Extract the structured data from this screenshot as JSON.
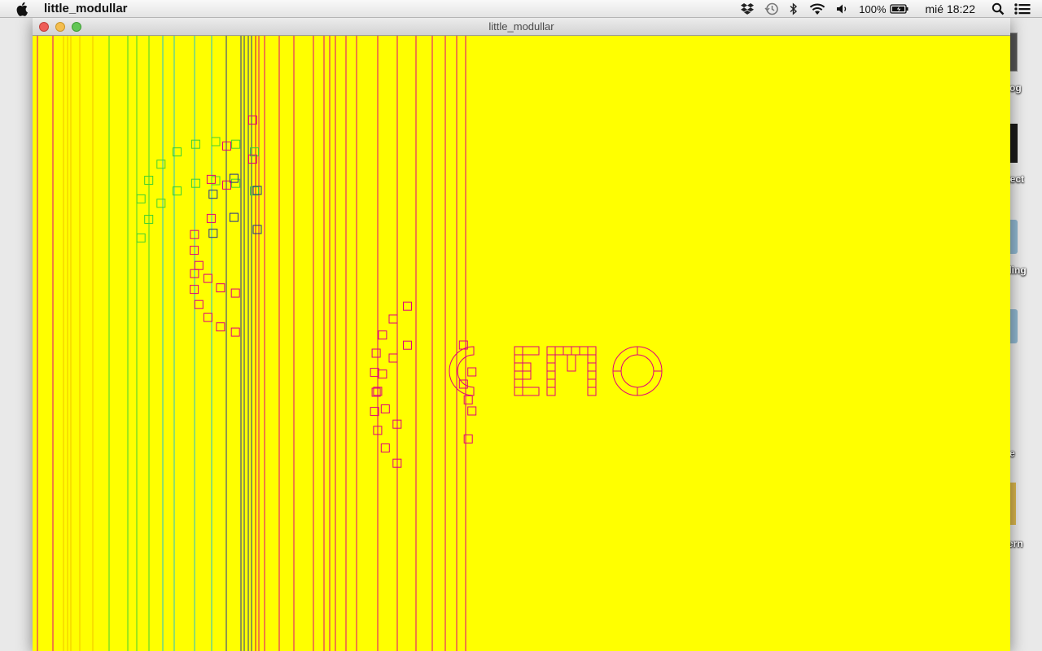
{
  "menubar": {
    "app_name": "little_modullar",
    "battery_percent": "100%",
    "clock": "mié 18:22",
    "icons": [
      "apple-logo-icon",
      "dropbox-icon",
      "time-machine-icon",
      "bluetooth-icon",
      "wifi-icon",
      "volume-icon",
      "battery-icon",
      "spotlight-icon",
      "notification-center-icon"
    ]
  },
  "window": {
    "title": "little_modullar"
  },
  "canvas": {
    "background": "#ffff00",
    "text": "DEMO",
    "colors": {
      "magenta": "#e0007a",
      "yellow_line": "#f0c000",
      "green": "#40d030",
      "cyan": "#20c0d0",
      "blue": "#203090",
      "red": "#d00040"
    }
  },
  "desktop": {
    "labels": [
      "og",
      "oject",
      "lling",
      "e",
      "ern"
    ]
  }
}
